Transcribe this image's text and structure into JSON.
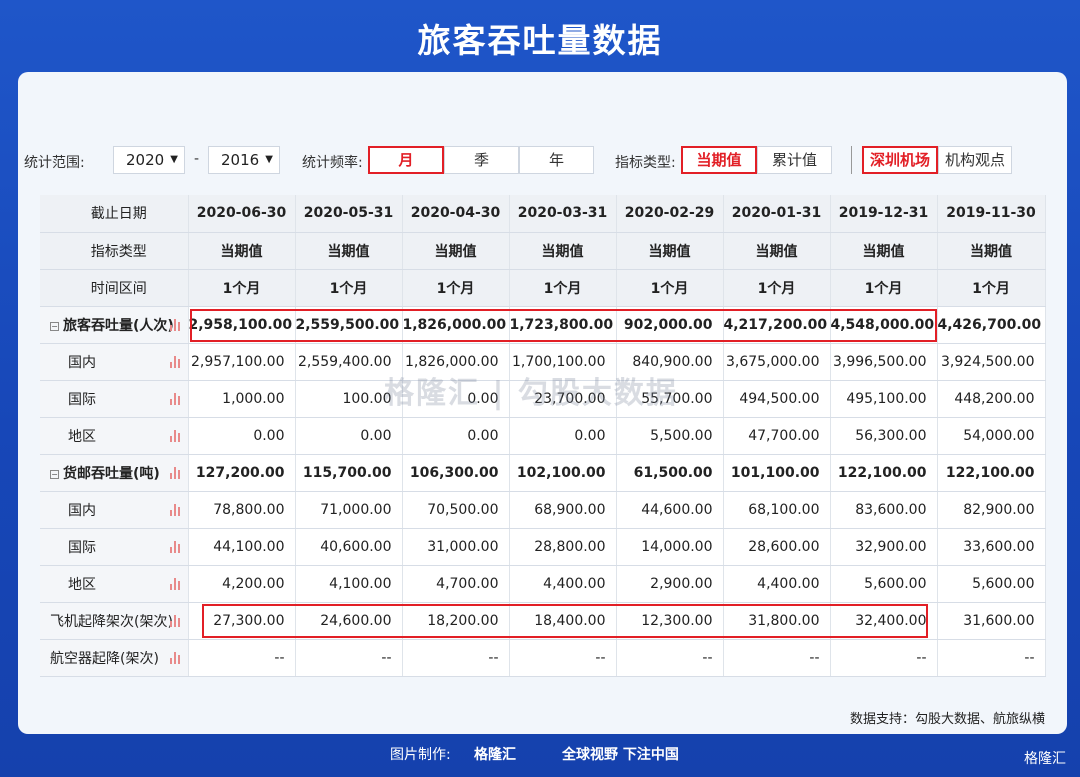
{
  "title": "旅客吞吐量数据",
  "controls": {
    "range_label": "统计范围:",
    "year_from": "2020",
    "dash": "-",
    "year_to": "2016",
    "freq_label": "统计频率:",
    "freq_options": [
      "月",
      "季",
      "年"
    ],
    "freq_selected": "月",
    "type_label": "指标类型:",
    "type_options": [
      "当期值",
      "累计值"
    ],
    "type_selected": "当期值",
    "airport_options": [
      "深圳机场",
      "机构观点"
    ],
    "airport_selected": "深圳机场"
  },
  "table": {
    "header_rows": [
      {
        "label": "截止日期",
        "cells": [
          "2020-06-30",
          "2020-05-31",
          "2020-04-30",
          "2020-03-31",
          "2020-02-29",
          "2020-01-31",
          "2019-12-31",
          "2019-11-30"
        ]
      },
      {
        "label": "指标类型",
        "cells": [
          "当期值",
          "当期值",
          "当期值",
          "当期值",
          "当期值",
          "当期值",
          "当期值",
          "当期值"
        ]
      },
      {
        "label": "时间区间",
        "cells": [
          "1个月",
          "1个月",
          "1个月",
          "1个月",
          "1个月",
          "1个月",
          "1个月",
          "1个月"
        ]
      }
    ],
    "rows": [
      {
        "label": "旅客吞吐量(人次)",
        "group": true,
        "cells": [
          "2,958,100.00",
          "2,559,500.00",
          "1,826,000.00",
          "1,723,800.00",
          "902,000.00",
          "4,217,200.00",
          "4,548,000.00",
          "4,426,700.00"
        ]
      },
      {
        "label": "国内",
        "group": false,
        "cells": [
          "2,957,100.00",
          "2,559,400.00",
          "1,826,000.00",
          "1,700,100.00",
          "840,900.00",
          "3,675,000.00",
          "3,996,500.00",
          "3,924,500.00"
        ]
      },
      {
        "label": "国际",
        "group": false,
        "cells": [
          "1,000.00",
          "100.00",
          "0.00",
          "23,700.00",
          "55,700.00",
          "494,500.00",
          "495,100.00",
          "448,200.00"
        ]
      },
      {
        "label": "地区",
        "group": false,
        "cells": [
          "0.00",
          "0.00",
          "0.00",
          "0.00",
          "5,500.00",
          "47,700.00",
          "56,300.00",
          "54,000.00"
        ]
      },
      {
        "label": "货邮吞吐量(吨)",
        "group": true,
        "cells": [
          "127,200.00",
          "115,700.00",
          "106,300.00",
          "102,100.00",
          "61,500.00",
          "101,100.00",
          "122,100.00",
          "122,100.00"
        ]
      },
      {
        "label": "国内",
        "group": false,
        "cells": [
          "78,800.00",
          "71,000.00",
          "70,500.00",
          "68,900.00",
          "44,600.00",
          "68,100.00",
          "83,600.00",
          "82,900.00"
        ]
      },
      {
        "label": "国际",
        "group": false,
        "cells": [
          "44,100.00",
          "40,600.00",
          "31,000.00",
          "28,800.00",
          "14,000.00",
          "28,600.00",
          "32,900.00",
          "33,600.00"
        ]
      },
      {
        "label": "地区",
        "group": false,
        "cells": [
          "4,200.00",
          "4,100.00",
          "4,700.00",
          "4,400.00",
          "2,900.00",
          "4,400.00",
          "5,600.00",
          "5,600.00"
        ]
      },
      {
        "label": "飞机起降架次(架次)",
        "group": false,
        "top": true,
        "cells": [
          "27,300.00",
          "24,600.00",
          "18,200.00",
          "18,400.00",
          "12,300.00",
          "31,800.00",
          "32,400.00",
          "31,600.00"
        ]
      },
      {
        "label": "航空器起降(架次)",
        "group": false,
        "top": true,
        "cells": [
          "--",
          "--",
          "--",
          "--",
          "--",
          "--",
          "--",
          "--"
        ]
      }
    ]
  },
  "watermark": "格隆汇 | 勾股大数据",
  "source": "数据支持：勾股大数据、航旅纵横",
  "footer": {
    "made_by": "图片制作:",
    "brand": "格隆汇",
    "slogan": "全球视野 下注中国",
    "corner_brand": "格隆汇"
  }
}
